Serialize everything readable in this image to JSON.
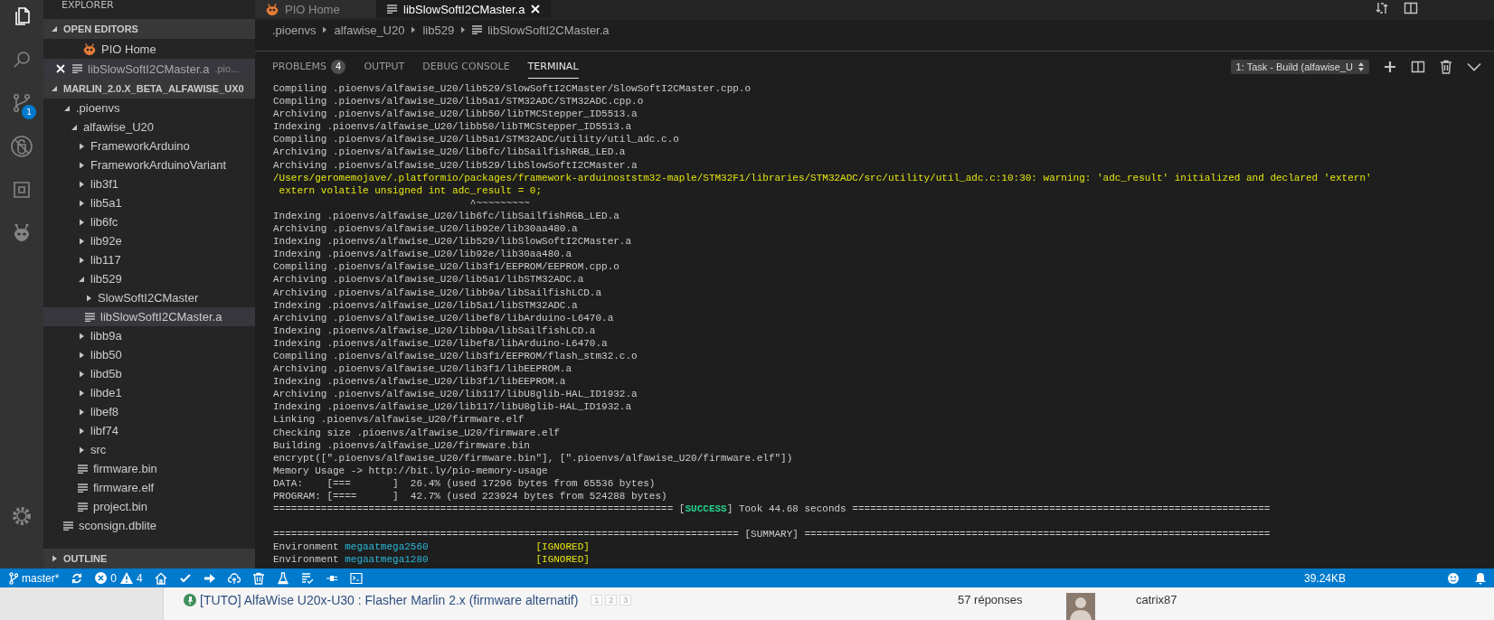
{
  "activity_bar": {
    "items": [
      {
        "kind": "files",
        "selected": true
      },
      {
        "kind": "search",
        "selected": false
      },
      {
        "kind": "source-control",
        "selected": false,
        "badge": "1"
      },
      {
        "kind": "debug",
        "selected": false
      },
      {
        "kind": "extensions",
        "selected": false
      },
      {
        "kind": "platformio",
        "selected": false
      }
    ],
    "bottom": [
      {
        "kind": "settings",
        "selected": false
      }
    ]
  },
  "sidebar": {
    "title": "EXPLORER",
    "open_editors": {
      "title": "OPEN EDITORS",
      "expanded": true,
      "items": [
        {
          "label": "PIO Home",
          "kind": "platformio",
          "selected": false,
          "close_visible": false
        },
        {
          "label": "libSlowSoftI2CMaster.a",
          "description": ".pio...",
          "kind": "file",
          "selected": true,
          "close_visible": true
        }
      ]
    },
    "folder": {
      "title": "MARLIN_2.0.X_BETA_ALFAWISE_UX0",
      "expanded": true,
      "tree": [
        {
          "label": ".pioenvs",
          "kind": "folder",
          "expanded": true,
          "selected": false,
          "children": [
            {
              "label": "alfawise_U20",
              "kind": "folder",
              "expanded": true,
              "selected": false,
              "children": [
                {
                  "label": "FrameworkArduino",
                  "kind": "folder",
                  "expanded": false,
                  "selected": false
                },
                {
                  "label": "FrameworkArduinoVariant",
                  "kind": "folder",
                  "expanded": false,
                  "selected": false
                },
                {
                  "label": "lib3f1",
                  "kind": "folder",
                  "expanded": false,
                  "selected": false
                },
                {
                  "label": "lib5a1",
                  "kind": "folder",
                  "expanded": false,
                  "selected": false
                },
                {
                  "label": "lib6fc",
                  "kind": "folder",
                  "expanded": false,
                  "selected": false
                },
                {
                  "label": "lib92e",
                  "kind": "folder",
                  "expanded": false,
                  "selected": false
                },
                {
                  "label": "lib117",
                  "kind": "folder",
                  "expanded": false,
                  "selected": false
                },
                {
                  "label": "lib529",
                  "kind": "folder",
                  "expanded": true,
                  "selected": false,
                  "children": [
                    {
                      "label": "SlowSoftI2CMaster",
                      "kind": "folder",
                      "expanded": false,
                      "selected": false
                    },
                    {
                      "label": "libSlowSoftI2CMaster.a",
                      "kind": "file",
                      "selected": true
                    }
                  ]
                },
                {
                  "label": "libb9a",
                  "kind": "folder",
                  "expanded": false,
                  "selected": false
                },
                {
                  "label": "libb50",
                  "kind": "folder",
                  "expanded": false,
                  "selected": false
                },
                {
                  "label": "libd5b",
                  "kind": "folder",
                  "expanded": false,
                  "selected": false
                },
                {
                  "label": "libde1",
                  "kind": "folder",
                  "expanded": false,
                  "selected": false
                },
                {
                  "label": "libef8",
                  "kind": "folder",
                  "expanded": false,
                  "selected": false
                },
                {
                  "label": "libf74",
                  "kind": "folder",
                  "expanded": false,
                  "selected": false
                },
                {
                  "label": "src",
                  "kind": "folder",
                  "expanded": false,
                  "selected": false
                },
                {
                  "label": "firmware.bin",
                  "kind": "file",
                  "selected": false
                },
                {
                  "label": "firmware.elf",
                  "kind": "file",
                  "selected": false
                },
                {
                  "label": "project.bin",
                  "kind": "file",
                  "selected": false
                }
              ]
            }
          ]
        },
        {
          "label": "sconsign.dblite",
          "kind": "file",
          "selected": false
        }
      ]
    },
    "outline": {
      "title": "OUTLINE",
      "expanded": false
    }
  },
  "editor_tabs": [
    {
      "label": "PIO Home",
      "kind": "platformio",
      "selected": false
    },
    {
      "label": "libSlowSoftI2CMaster.a",
      "kind": "file",
      "selected": true
    }
  ],
  "breadcrumbs": [
    {
      "label": ".pioenvs",
      "kind": "folder"
    },
    {
      "label": "alfawise_U20",
      "kind": "folder"
    },
    {
      "label": "lib529",
      "kind": "folder"
    },
    {
      "label": "libSlowSoftI2CMaster.a",
      "kind": "file"
    }
  ],
  "panel": {
    "tabs": [
      {
        "label": "PROBLEMS",
        "badge": "4",
        "selected": false
      },
      {
        "label": "OUTPUT",
        "selected": false
      },
      {
        "label": "DEBUG CONSOLE",
        "selected": false
      },
      {
        "label": "TERMINAL",
        "selected": true
      }
    ],
    "terminal_select": "1: Task - Build (alfawise_U",
    "lines": [
      {
        "kind": "plain",
        "text": "Compiling .pioenvs/alfawise_U20/lib529/SlowSoftI2CMaster/SlowSoftI2CMaster.cpp.o"
      },
      {
        "kind": "plain",
        "text": "Compiling .pioenvs/alfawise_U20/lib5a1/STM32ADC/STM32ADC.cpp.o"
      },
      {
        "kind": "plain",
        "text": "Archiving .pioenvs/alfawise_U20/libb50/libTMCStepper_ID5513.a"
      },
      {
        "kind": "plain",
        "text": "Indexing .pioenvs/alfawise_U20/libb50/libTMCStepper_ID5513.a"
      },
      {
        "kind": "plain",
        "text": "Compiling .pioenvs/alfawise_U20/lib5a1/STM32ADC/utility/util_adc.c.o"
      },
      {
        "kind": "plain",
        "text": "Archiving .pioenvs/alfawise_U20/lib6fc/libSailfishRGB_LED.a"
      },
      {
        "kind": "plain",
        "text": "Archiving .pioenvs/alfawise_U20/lib529/libSlowSoftI2CMaster.a"
      },
      {
        "kind": "warning",
        "text": "/Users/geromemojave/.platformio/packages/framework-arduinoststm32-maple/STM32F1/libraries/STM32ADC/src/utility/util_adc.c:10:30: warning: 'adc_result' initialized and declared 'extern'"
      },
      {
        "kind": "warning",
        "text": " extern volatile unsigned int adc_result = 0;"
      },
      {
        "kind": "plain",
        "text": "                                 ^~~~~~~~~~"
      },
      {
        "kind": "plain",
        "text": "Indexing .pioenvs/alfawise_U20/lib6fc/libSailfishRGB_LED.a"
      },
      {
        "kind": "plain",
        "text": "Archiving .pioenvs/alfawise_U20/lib92e/lib30aa480.a"
      },
      {
        "kind": "plain",
        "text": "Indexing .pioenvs/alfawise_U20/lib529/libSlowSoftI2CMaster.a"
      },
      {
        "kind": "plain",
        "text": "Indexing .pioenvs/alfawise_U20/lib92e/lib30aa480.a"
      },
      {
        "kind": "plain",
        "text": "Compiling .pioenvs/alfawise_U20/lib3f1/EEPROM/EEPROM.cpp.o"
      },
      {
        "kind": "plain",
        "text": "Archiving .pioenvs/alfawise_U20/lib5a1/libSTM32ADC.a"
      },
      {
        "kind": "plain",
        "text": "Archiving .pioenvs/alfawise_U20/libb9a/libSailfishLCD.a"
      },
      {
        "kind": "plain",
        "text": "Indexing .pioenvs/alfawise_U20/lib5a1/libSTM32ADC.a"
      },
      {
        "kind": "plain",
        "text": "Archiving .pioenvs/alfawise_U20/libef8/libArduino-L6470.a"
      },
      {
        "kind": "plain",
        "text": "Indexing .pioenvs/alfawise_U20/libb9a/libSailfishLCD.a"
      },
      {
        "kind": "plain",
        "text": "Indexing .pioenvs/alfawise_U20/libef8/libArduino-L6470.a"
      },
      {
        "kind": "plain",
        "text": "Compiling .pioenvs/alfawise_U20/lib3f1/EEPROM/flash_stm32.c.o"
      },
      {
        "kind": "plain",
        "text": "Archiving .pioenvs/alfawise_U20/lib3f1/libEEPROM.a"
      },
      {
        "kind": "plain",
        "text": "Indexing .pioenvs/alfawise_U20/lib3f1/libEEPROM.a"
      },
      {
        "kind": "plain",
        "text": "Archiving .pioenvs/alfawise_U20/lib117/libU8glib-HAL_ID1932.a"
      },
      {
        "kind": "plain",
        "text": "Indexing .pioenvs/alfawise_U20/lib117/libU8glib-HAL_ID1932.a"
      },
      {
        "kind": "plain",
        "text": "Linking .pioenvs/alfawise_U20/firmware.elf"
      },
      {
        "kind": "plain",
        "text": "Checking size .pioenvs/alfawise_U20/firmware.elf"
      },
      {
        "kind": "plain",
        "text": "Building .pioenvs/alfawise_U20/firmware.bin"
      },
      {
        "kind": "plain",
        "text": "encrypt([\".pioenvs/alfawise_U20/firmware.bin\"], [\".pioenvs/alfawise_U20/firmware.elf\"])"
      },
      {
        "kind": "plain",
        "text": "Memory Usage -> http://bit.ly/pio-memory-usage"
      },
      {
        "kind": "plain",
        "text": "DATA:    [===       ]  26.4% (used 17296 bytes from 65536 bytes)"
      },
      {
        "kind": "plain",
        "text": "PROGRAM: [====      ]  42.7% (used 223924 bytes from 524288 bytes)"
      },
      {
        "kind": "result",
        "before": "=================================================================== [",
        "status": "SUCCESS",
        "after": "] Took 44.68 seconds ======================================================================"
      },
      {
        "kind": "blank"
      },
      {
        "kind": "plain",
        "text": "============================================================================== [SUMMARY] =============================================================================="
      },
      {
        "kind": "env",
        "label": "Environment ",
        "name": "megaatmega2560",
        "status": "[IGNORED]"
      },
      {
        "kind": "env",
        "label": "Environment ",
        "name": "megaatmega1280",
        "status": "[IGNORED]"
      }
    ]
  },
  "status_bar": {
    "left": [
      {
        "kind": "branch",
        "text": "master*"
      },
      {
        "kind": "sync"
      },
      {
        "kind": "problems",
        "errors": "0",
        "warnings": "4"
      },
      {
        "kind": "home"
      },
      {
        "kind": "check"
      },
      {
        "kind": "arrow"
      },
      {
        "kind": "upload"
      },
      {
        "kind": "trash"
      },
      {
        "kind": "flask"
      },
      {
        "kind": "tasks"
      },
      {
        "kind": "plug"
      },
      {
        "kind": "terminal"
      }
    ],
    "right": [
      {
        "kind": "text",
        "text": "39.24KB"
      },
      {
        "kind": "smiley"
      },
      {
        "kind": "bell"
      }
    ]
  },
  "forum_row": {
    "title": "[TUTO] AlfaWise U20x-U30 : Flasher Marlin 2.x (firmware alternatif)",
    "pages": [
      "1",
      "2",
      "3"
    ],
    "replies": "57 réponses",
    "author": "catrix87"
  }
}
